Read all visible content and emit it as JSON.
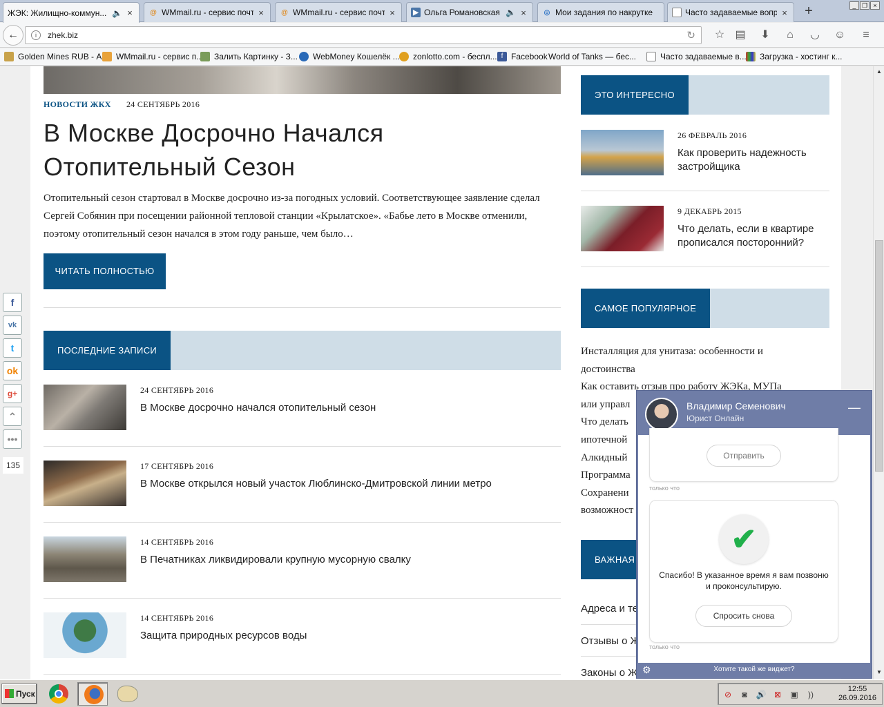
{
  "browser": {
    "tabs": [
      {
        "title": "ЖЭК: Жилищно-коммун...",
        "active": true
      },
      {
        "title": "WMmail.ru - сервис почт..."
      },
      {
        "title": "WMmail.ru - сервис почт..."
      },
      {
        "title": "Ольга Романовская ..."
      },
      {
        "title": "Мои задания по накрутке"
      },
      {
        "title": "Часто задаваемые вопр..."
      }
    ],
    "url": "zhek.biz",
    "bookmarks": [
      "Golden Mines RUB - А...",
      "WMmail.ru - сервис п...",
      "Залить Картинку - З...",
      "WebMoney Кошелёк ...",
      "zonlotto.com - беспл...",
      "Facebook",
      "World of Tanks — бес...",
      "Часто задаваемые в...",
      "Загрузка - хостинг к..."
    ]
  },
  "article": {
    "category": "НОВОСТИ ЖКХ",
    "date": "24 СЕНТЯБРЬ 2016",
    "title_line1": "В Москве Досрочно Начался",
    "title_line2": "Отопительный Сезон",
    "excerpt": "Отопительный сезон стартовал в Москве досрочно из-за погодных условий. Соответствующее заявление сделал Сергей Собянин при посещении районной тепловой станции «Крылатское». «Бабье лето в Москве отменили, поэтому отопительный сезон начался в этом году раньше, чем было…",
    "read_more": "ЧИТАТЬ ПОЛНОСТЬЮ"
  },
  "recent": {
    "heading": "ПОСЛЕДНИЕ ЗАПИСИ",
    "items": [
      {
        "date": "24 СЕНТЯБРЬ 2016",
        "title": "В Москве досрочно начался отопительный сезон"
      },
      {
        "date": "17 СЕНТЯБРЬ 2016",
        "title": "В Москве открылся новый участок Люблинско-Дмитровской линии метро"
      },
      {
        "date": "14 СЕНТЯБРЬ 2016",
        "title": "В Печатниках ликвидировали крупную мусорную свалку"
      },
      {
        "date": "14 СЕНТЯБРЬ 2016",
        "title": "Защита природных ресурсов воды"
      }
    ]
  },
  "sidebar": {
    "interesting_heading": "ЭТО ИНТЕРЕСНО",
    "interesting": [
      {
        "date": "26 ФЕВРАЛЬ 2016",
        "title": "Как проверить надежность застройщика"
      },
      {
        "date": "9 ДЕКАБРЬ 2015",
        "title": "Что делать, если в квартире прописался посторонний?"
      }
    ],
    "popular_heading": "САМОЕ ПОПУЛЯРНОЕ",
    "popular": [
      "Инсталляция для унитаза: особенности и",
      "достоинства",
      "Как оставить отзыв про работу ЖЭКа, МУПа",
      "или управл",
      "Что делать",
      "ипотечной",
      "Алкидный",
      "Программа",
      "Сохранени",
      "возможност"
    ],
    "important_heading": "ВАЖНАЯ",
    "important_links": [
      "Адреса и те",
      "Отзывы о Ж",
      "Законы о Ж"
    ]
  },
  "share": {
    "count": "135"
  },
  "chat": {
    "name": "Владимир Семенович",
    "role": "Юрист Онлайн",
    "send_button": "Отправить",
    "just_now": "только что",
    "thanks": "Спасибо! В указанное время я вам позвоню и проконсультирую.",
    "ask_again": "Спросить снова",
    "footer": "Хотите такой же виджет?"
  },
  "taskbar": {
    "start": "Пуск",
    "time": "12:55",
    "date": "26.09.2016"
  }
}
